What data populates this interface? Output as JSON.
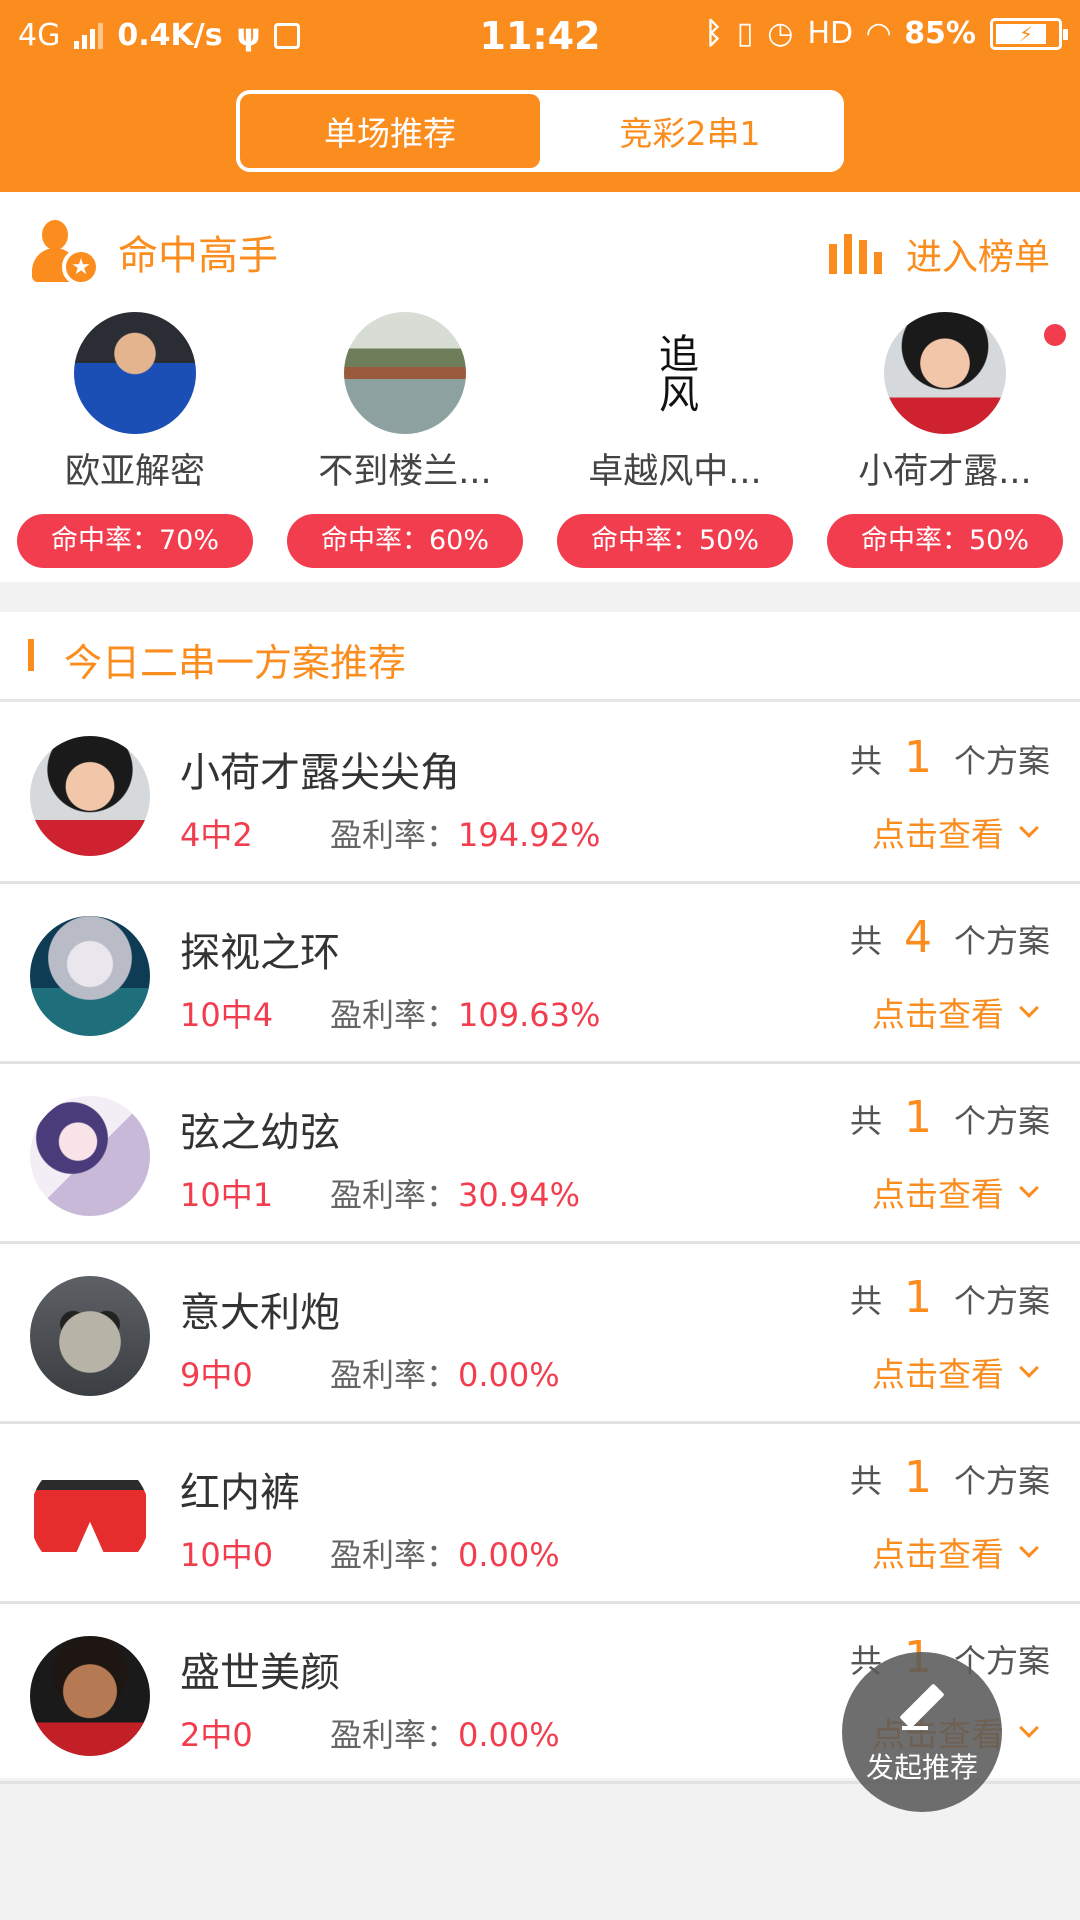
{
  "status_bar": {
    "network": "4G",
    "speed": "0.4K/s",
    "time": "11:42",
    "hd": "HD",
    "battery": "85%"
  },
  "tabs": [
    {
      "label": "单场推荐",
      "active": true
    },
    {
      "label": "竞彩2串1",
      "active": false
    }
  ],
  "masters": {
    "title": "命中高手",
    "ranking_label": "进入榜单",
    "items": [
      {
        "name": "欧亚解密",
        "rate": "命中率：70%",
        "avatar": "av-hazard"
      },
      {
        "name": "不到楼兰...",
        "rate": "命中率：60%",
        "avatar": "av-lake"
      },
      {
        "name": "卓越风中...",
        "rate": "命中率：50%",
        "avatar": "av-calli"
      },
      {
        "name": "小荷才露...",
        "rate": "命中率：50%",
        "avatar": "av-girl"
      }
    ]
  },
  "today": {
    "title": "今日二串一方案推荐",
    "gong": "共",
    "plans_suffix": "个方案",
    "view_label": "点击查看",
    "profit_label": "盈利率：",
    "rows": [
      {
        "name": "小荷才露尖尖角",
        "record": "4中2",
        "profit": "194.92%",
        "count": "1",
        "avatar": "av-girl"
      },
      {
        "name": "探视之环",
        "record": "10中4",
        "profit": "109.63%",
        "count": "4",
        "avatar": "av-anime1"
      },
      {
        "name": "弦之幼弦",
        "record": "10中1",
        "profit": "30.94%",
        "count": "1",
        "avatar": "av-anime2"
      },
      {
        "name": "意大利炮",
        "record": "9中0",
        "profit": "0.00%",
        "count": "1",
        "avatar": "av-binoc"
      },
      {
        "name": "红内裤",
        "record": "10中0",
        "profit": "0.00%",
        "count": "1",
        "avatar": "av-shorts"
      },
      {
        "name": "盛世美颜",
        "record": "2中0",
        "profit": "0.00%",
        "count": "1",
        "avatar": "av-costa"
      }
    ]
  },
  "fab": {
    "label": "发起推荐"
  },
  "colors": {
    "accent": "#fb8c1e",
    "red": "#f23d4e",
    "background": "#f2f2f2"
  },
  "icons": [
    "bluetooth-icon",
    "vibrate-icon",
    "alarm-icon",
    "wifi-icon",
    "battery-icon",
    "user-star-icon",
    "bar-chart-icon",
    "chevron-down-icon",
    "pencil-icon"
  ]
}
